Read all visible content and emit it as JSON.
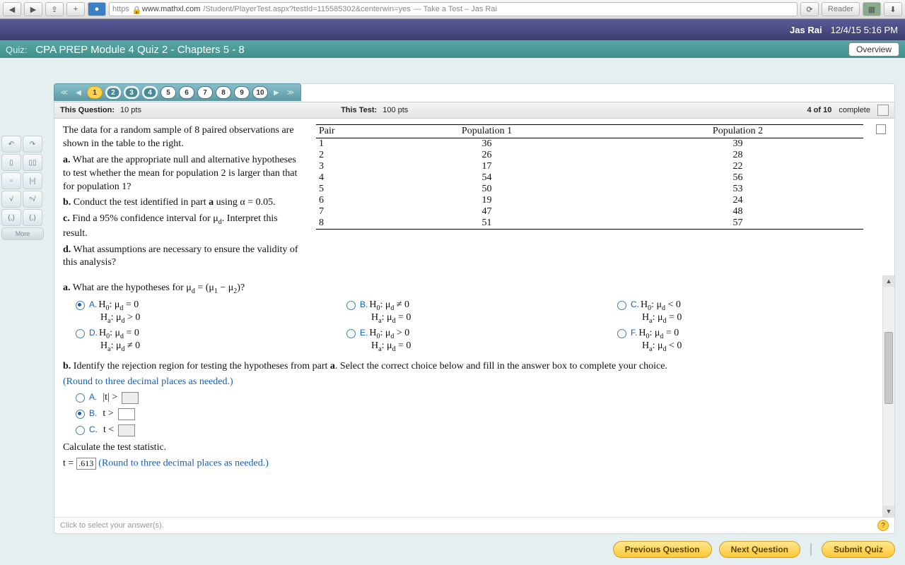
{
  "browser": {
    "scheme": "https",
    "host": "www.mathxl.com",
    "path": "/Student/PlayerTest.aspx?testId=115585302&centerwin=yes",
    "title_suffix": " — Take a Test – Jas Rai",
    "reader": "Reader"
  },
  "header": {
    "user": "Jas Rai",
    "datetime": "12/4/15 5:16 PM",
    "quiz_label": "Quiz:",
    "quiz_title": "CPA PREP Module 4 Quiz 2 - Chapters 5 - 8",
    "overview": "Overview"
  },
  "nav": {
    "items": [
      "1",
      "2",
      "3",
      "4",
      "5",
      "6",
      "7",
      "8",
      "9",
      "10"
    ],
    "current": "1",
    "circled": [
      "2",
      "3",
      "4"
    ]
  },
  "info": {
    "this_q_label": "This Question:",
    "this_q_pts": "10 pts",
    "this_t_label": "This Test:",
    "this_t_pts": "100 pts",
    "progress": "4 of 10",
    "complete": "complete"
  },
  "problem": {
    "intro": "The data for a random sample of 8 paired observations are shown in the table to the right.",
    "a": "a. What are the appropriate null and alternative hypotheses to test whether the mean for population 2 is larger than that for population 1?",
    "b": "b. Conduct the test identified in part a using α = 0.05.",
    "c": "c. Find a 95% confidence interval for μ_d. Interpret this result.",
    "d": "d. What assumptions are necessary to ensure the validity of this analysis?"
  },
  "table": {
    "headers": [
      "Pair",
      "Population 1",
      "Population 2"
    ],
    "rows": [
      [
        "1",
        "36",
        "39"
      ],
      [
        "2",
        "26",
        "28"
      ],
      [
        "3",
        "17",
        "22"
      ],
      [
        "4",
        "54",
        "56"
      ],
      [
        "5",
        "50",
        "53"
      ],
      [
        "6",
        "19",
        "24"
      ],
      [
        "7",
        "47",
        "48"
      ],
      [
        "8",
        "51",
        "57"
      ]
    ]
  },
  "qa": {
    "prompt": "a. What are the hypotheses for μ_d = (μ₁ − μ₂)?",
    "options": [
      {
        "key": "A.",
        "h0": "H₀: μ_d = 0",
        "ha": "Hₐ: μ_d > 0",
        "sel": true
      },
      {
        "key": "B.",
        "h0": "H₀: μ_d ≠ 0",
        "ha": "Hₐ: μ_d = 0",
        "sel": false
      },
      {
        "key": "C.",
        "h0": "H₀: μ_d < 0",
        "ha": "Hₐ: μ_d = 0",
        "sel": false
      },
      {
        "key": "D.",
        "h0": "H₀: μ_d = 0",
        "ha": "Hₐ: μ_d ≠ 0",
        "sel": false
      },
      {
        "key": "E.",
        "h0": "H₀: μ_d > 0",
        "ha": "Hₐ: μ_d = 0",
        "sel": false
      },
      {
        "key": "F.",
        "h0": "H₀: μ_d = 0",
        "ha": "Hₐ: μ_d < 0",
        "sel": false
      }
    ]
  },
  "qb": {
    "prompt": "b. Identify the rejection region for testing the hypotheses from part a. Select the correct choice below and fill in the answer box to complete your choice.",
    "round_hint": "(Round to three decimal places as needed.)",
    "options": [
      {
        "key": "A.",
        "text": "|t| >",
        "sel": false
      },
      {
        "key": "B.",
        "text": "t >",
        "sel": true
      },
      {
        "key": "C.",
        "text": "t <",
        "sel": false
      }
    ],
    "stat_prompt": "Calculate the test statistic.",
    "stat_prefix": "t = ",
    "stat_value": ".613",
    "stat_hint": "(Round to three decimal places as needed.)"
  },
  "footer": {
    "hint": "Click to select your answer(s).",
    "prev": "Previous Question",
    "next": "Next Question",
    "submit": "Submit Quiz"
  },
  "sidebar": {
    "more": "More"
  },
  "chart_data": {
    "type": "table",
    "columns": [
      "Pair",
      "Population 1",
      "Population 2"
    ],
    "rows": [
      [
        1,
        36,
        39
      ],
      [
        2,
        26,
        28
      ],
      [
        3,
        17,
        22
      ],
      [
        4,
        54,
        56
      ],
      [
        5,
        50,
        53
      ],
      [
        6,
        19,
        24
      ],
      [
        7,
        47,
        48
      ],
      [
        8,
        51,
        57
      ]
    ]
  }
}
